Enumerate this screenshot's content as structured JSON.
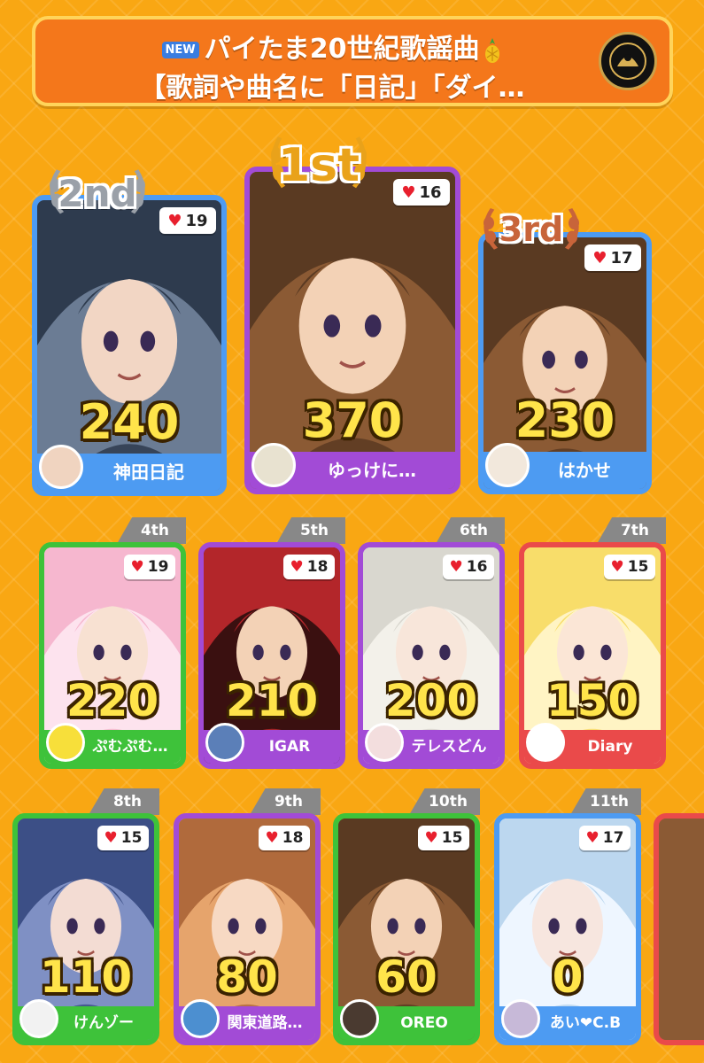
{
  "banner": {
    "new_badge": "NEW",
    "title_line1": "パイたま20世紀歌謡曲",
    "title_line2": "【歌詞や曲名に「日記」「ダイ…",
    "pineapple_icon": "pineapple-icon",
    "logo_icon": "crest-logo-icon"
  },
  "top3": [
    {
      "rank": "2nd",
      "score": "240",
      "likes": "19",
      "name": "神田日記",
      "color": "#4d9bf2"
    },
    {
      "rank": "1st",
      "score": "370",
      "likes": "16",
      "name": "ゆっけに…",
      "color": "#a24bd6"
    },
    {
      "rank": "3rd",
      "score": "230",
      "likes": "17",
      "name": "はかせ",
      "color": "#4d9bf2"
    }
  ],
  "row2": [
    {
      "rank": "4th",
      "score": "220",
      "likes": "19",
      "name": "ぷむぷむ…",
      "color": "#3ec23a"
    },
    {
      "rank": "5th",
      "score": "210",
      "likes": "18",
      "name": "IGAR",
      "color": "#a24bd6"
    },
    {
      "rank": "6th",
      "score": "200",
      "likes": "16",
      "name": "テレスどん",
      "color": "#a24bd6"
    },
    {
      "rank": "7th",
      "score": "150",
      "likes": "15",
      "name": "Diary",
      "color": "#ea4a4a"
    }
  ],
  "row3": [
    {
      "rank": "8th",
      "score": "110",
      "likes": "15",
      "name": "けんゾー",
      "color": "#3ec23a"
    },
    {
      "rank": "9th",
      "score": "80",
      "likes": "18",
      "name": "関東道路…",
      "color": "#a24bd6"
    },
    {
      "rank": "10th",
      "score": "60",
      "likes": "15",
      "name": "OREO",
      "color": "#3ec23a"
    },
    {
      "rank": "11th",
      "score": "0",
      "likes": "17",
      "name": "あい❤C.B",
      "color": "#4d9bf2"
    }
  ],
  "heart_icon": "♥"
}
